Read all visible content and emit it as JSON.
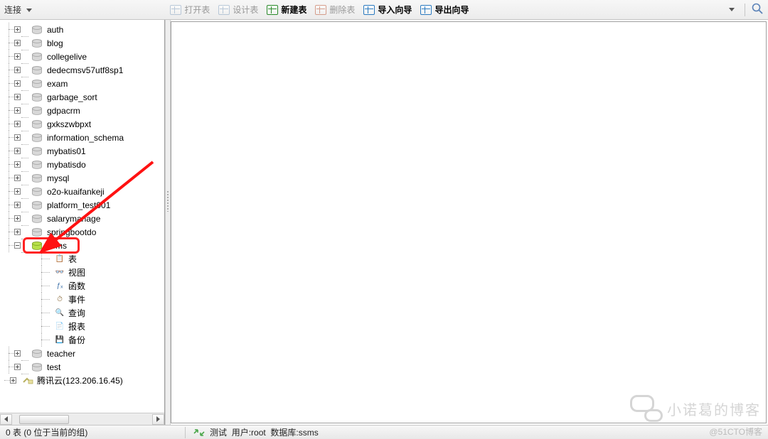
{
  "toolbar": {
    "connection_label": "连接",
    "buttons": {
      "open_table": "打开表",
      "design_table": "设计表",
      "new_table": "新建表",
      "delete_table": "删除表",
      "import_wizard": "导入向导",
      "export_wizard": "导出向导"
    }
  },
  "sidebar": {
    "databases": [
      "auth",
      "blog",
      "collegelive",
      "dedecmsv57utf8sp1",
      "exam",
      "garbage_sort",
      "gdpacrm",
      "gxkszwbpxt",
      "information_schema",
      "mybatis01",
      "mybatisdo",
      "mysql",
      "o2o-kuaifankeji",
      "platform_test001",
      "salarymanage",
      "springbootdo",
      "ssms"
    ],
    "selected_db": "ssms",
    "sub_items": {
      "tables": "表",
      "views": "视图",
      "functions": "函数",
      "events": "事件",
      "queries": "查询",
      "reports": "报表",
      "backups": "备份"
    },
    "after_databases": [
      "teacher",
      "test"
    ],
    "connection_node": "腾讯云(123.206.16.45)"
  },
  "status": {
    "left": "0 表 (0 位于当前的组)",
    "conn_name": "测试",
    "user_label": "用户: ",
    "user_value": "root",
    "db_label": "数据库: ",
    "db_value": "ssms"
  },
  "watermark": {
    "text": "小诺葛的博客"
  },
  "copyright": "@51CTO博客"
}
